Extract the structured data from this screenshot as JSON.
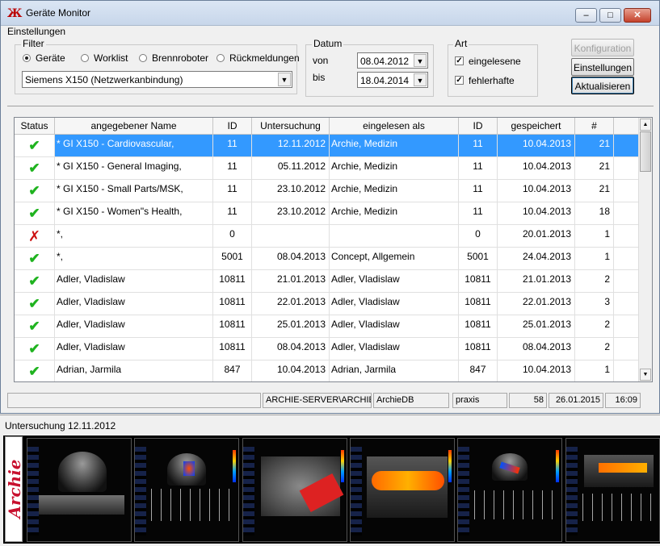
{
  "window": {
    "title": "Geräte Monitor",
    "icon": "archie-app-icon"
  },
  "settings": {
    "group_label": "Einstellungen",
    "filter": {
      "label": "Filter",
      "options": [
        "Geräte",
        "Worklist",
        "Brennroboter",
        "Rückmeldungen"
      ],
      "selected": "Geräte",
      "device_value": "Siemens X150 (Netzwerkanbindung)"
    },
    "datum": {
      "label": "Datum",
      "from_label": "von",
      "from_value": "08.04.2012",
      "to_label": "bis",
      "to_value": "18.04.2014"
    },
    "art": {
      "label": "Art",
      "items": [
        {
          "label": "eingelesene",
          "checked": true
        },
        {
          "label": "fehlerhafte",
          "checked": true
        }
      ]
    },
    "buttons": {
      "configuration": "Konfiguration",
      "settings": "Einstellungen",
      "refresh": "Aktualisieren"
    }
  },
  "table": {
    "columns": [
      "Status",
      "angegebener Name",
      "ID",
      "Untersuchung",
      "eingelesen als",
      "ID",
      "gespeichert",
      "#"
    ],
    "rows": [
      {
        "status": "ok",
        "name": "* GI X150 - Cardiovascular,",
        "id": "11",
        "exam": "12.11.2012",
        "read_as": "Archie, Medizin",
        "id2": "11",
        "saved": "10.04.2013",
        "count": "21",
        "selected": true
      },
      {
        "status": "ok",
        "name": "* GI X150 - General Imaging,",
        "id": "11",
        "exam": "05.11.2012",
        "read_as": "Archie, Medizin",
        "id2": "11",
        "saved": "10.04.2013",
        "count": "21"
      },
      {
        "status": "ok",
        "name": "* GI X150 - Small Parts/MSK,",
        "id": "11",
        "exam": "23.10.2012",
        "read_as": "Archie, Medizin",
        "id2": "11",
        "saved": "10.04.2013",
        "count": "21"
      },
      {
        "status": "ok",
        "name": "* GI X150 - Women\"s Health,",
        "id": "11",
        "exam": "23.10.2012",
        "read_as": "Archie, Medizin",
        "id2": "11",
        "saved": "10.04.2013",
        "count": "18"
      },
      {
        "status": "error",
        "name": "*,",
        "id": "0",
        "exam": "",
        "read_as": "",
        "id2": "0",
        "saved": "20.01.2013",
        "count": "1"
      },
      {
        "status": "ok",
        "name": "*,",
        "id": "5001",
        "exam": "08.04.2013",
        "read_as": "Concept, Allgemein",
        "id2": "5001",
        "saved": "24.04.2013",
        "count": "1"
      },
      {
        "status": "ok",
        "name": "Adler, Vladislaw",
        "id": "10811",
        "exam": "21.01.2013",
        "read_as": "Adler, Vladislaw",
        "id2": "10811",
        "saved": "21.01.2013",
        "count": "2"
      },
      {
        "status": "ok",
        "name": "Adler, Vladislaw",
        "id": "10811",
        "exam": "22.01.2013",
        "read_as": "Adler, Vladislaw",
        "id2": "10811",
        "saved": "22.01.2013",
        "count": "3"
      },
      {
        "status": "ok",
        "name": "Adler, Vladislaw",
        "id": "10811",
        "exam": "25.01.2013",
        "read_as": "Adler, Vladislaw",
        "id2": "10811",
        "saved": "25.01.2013",
        "count": "2"
      },
      {
        "status": "ok",
        "name": "Adler, Vladislaw",
        "id": "10811",
        "exam": "08.04.2013",
        "read_as": "Adler, Vladislaw",
        "id2": "10811",
        "saved": "08.04.2013",
        "count": "2"
      },
      {
        "status": "ok",
        "name": "Adrian, Jarmila",
        "id": "847",
        "exam": "10.04.2013",
        "read_as": "Adrian, Jarmila",
        "id2": "847",
        "saved": "10.04.2013",
        "count": "1"
      }
    ]
  },
  "statusbar": {
    "server": "ARCHIE-SERVER\\ARCHIE",
    "db": "ArchieDB",
    "user": "praxis",
    "count": "58",
    "date": "26.01.2015",
    "time": "16:09"
  },
  "preview": {
    "title": "Untersuchung 12.11.2012",
    "logo_text": "Archie",
    "thumbnails": [
      "echo-cardio-image",
      "doppler-spectral-image",
      "vascular-color-doppler-image",
      "carotid-power-doppler-image",
      "color-doppler-spectral-image",
      "spectral-doppler-image"
    ]
  },
  "colors": {
    "selection": "#3399ff",
    "ok": "#1fb31f",
    "error": "#cc1111",
    "logo": "#c8102e"
  }
}
